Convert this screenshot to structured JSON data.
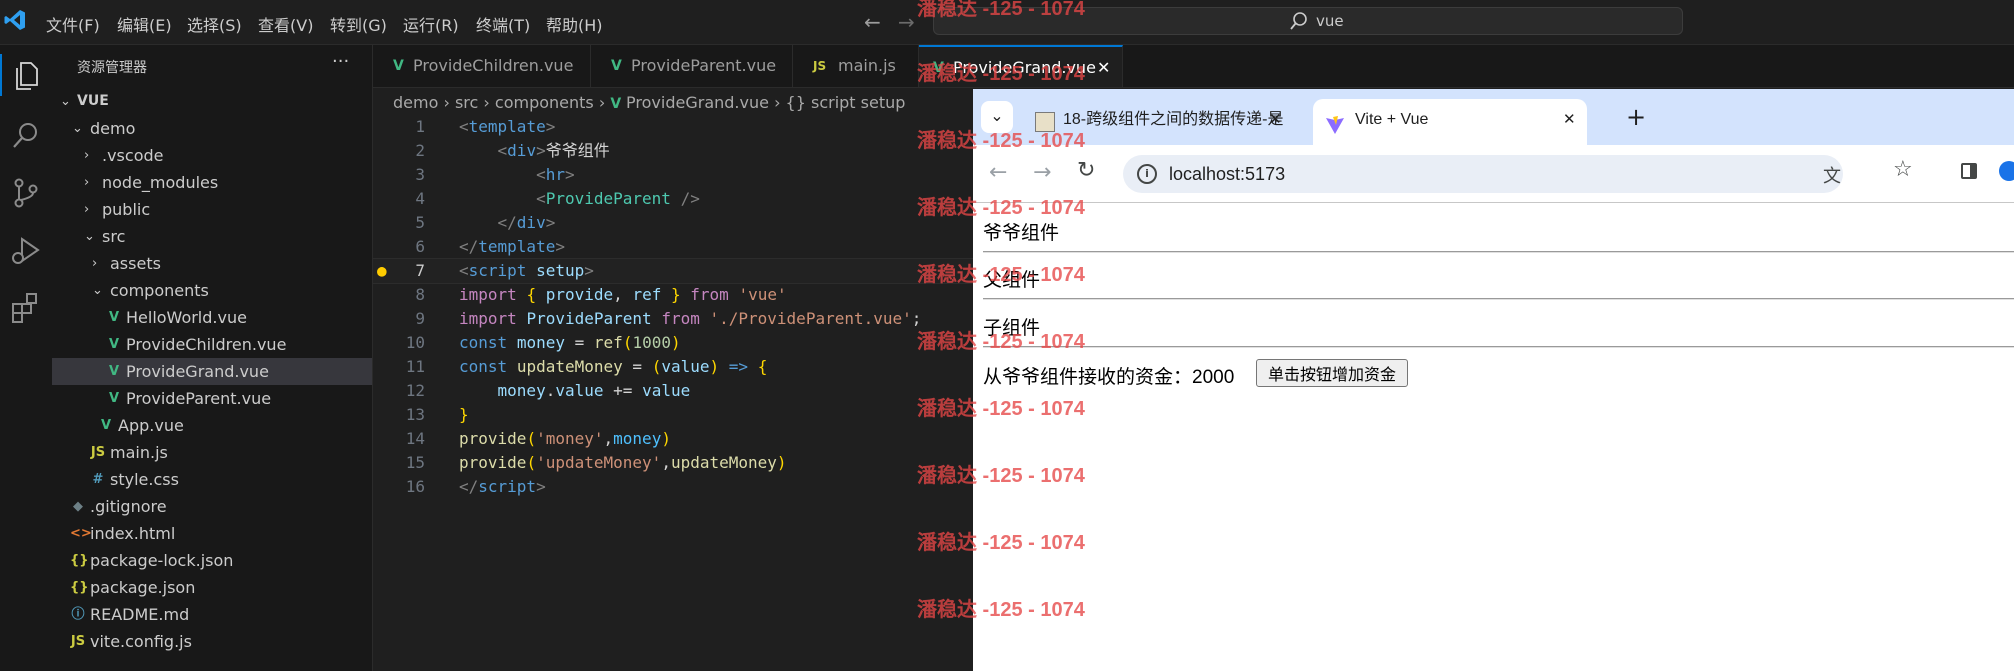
{
  "titlebar": {
    "menus": [
      "文件(F)",
      "编辑(E)",
      "选择(S)",
      "查看(V)",
      "转到(G)",
      "运行(R)",
      "终端(T)",
      "帮助(H)"
    ],
    "search_text": "vue"
  },
  "sidebar": {
    "title": "资源管理器",
    "more": "···",
    "root": "VUE",
    "items": [
      {
        "label": "demo",
        "kind": "folder-open"
      },
      {
        "label": ".vscode",
        "kind": "folder"
      },
      {
        "label": "node_modules",
        "kind": "folder"
      },
      {
        "label": "public",
        "kind": "folder"
      },
      {
        "label": "src",
        "kind": "folder-open"
      },
      {
        "label": "assets",
        "kind": "folder"
      },
      {
        "label": "components",
        "kind": "folder-open"
      },
      {
        "label": "HelloWorld.vue",
        "kind": "vue"
      },
      {
        "label": "ProvideChildren.vue",
        "kind": "vue"
      },
      {
        "label": "ProvideGrand.vue",
        "kind": "vue",
        "selected": true
      },
      {
        "label": "ProvideParent.vue",
        "kind": "vue"
      },
      {
        "label": "App.vue",
        "kind": "vue"
      },
      {
        "label": "main.js",
        "kind": "js"
      },
      {
        "label": "style.css",
        "kind": "css"
      },
      {
        "label": ".gitignore",
        "kind": "git"
      },
      {
        "label": "index.html",
        "kind": "html"
      },
      {
        "label": "package-lock.json",
        "kind": "json"
      },
      {
        "label": "package.json",
        "kind": "json"
      },
      {
        "label": "README.md",
        "kind": "info"
      },
      {
        "label": "vite.config.js",
        "kind": "js"
      }
    ]
  },
  "editor": {
    "tabs": [
      {
        "label": "ProvideChildren.vue",
        "kind": "vue"
      },
      {
        "label": "ProvideParent.vue",
        "kind": "vue"
      },
      {
        "label": "main.js",
        "kind": "js"
      },
      {
        "label": "ProvideGrand.vue",
        "kind": "vue",
        "active": true
      }
    ],
    "breadcrumb": [
      "demo",
      "src",
      "components",
      "ProvideGrand.vue",
      "{} script setup"
    ],
    "current_line": 7,
    "line_numbers": [
      "1",
      "2",
      "3",
      "4",
      "5",
      "6",
      "7",
      "8",
      "9",
      "10",
      "11",
      "12",
      "13",
      "14",
      "15",
      "16"
    ]
  },
  "browser": {
    "tabs": [
      {
        "title": "18-跨级组件之间的数据传递-是",
        "active": false
      },
      {
        "title": "Vite + Vue",
        "active": true
      }
    ],
    "new_tab": "+",
    "url": "localhost:5173",
    "page": {
      "grand_heading": "爷爷组件",
      "parent_heading": "父组件",
      "child_heading": "子组件",
      "money_label": "从爷爷组件接收的资金：",
      "money_value": "2000",
      "button_label": "单击按钮增加资金"
    }
  },
  "watermark": {
    "text": "潘稳达 -125 - 1074"
  }
}
